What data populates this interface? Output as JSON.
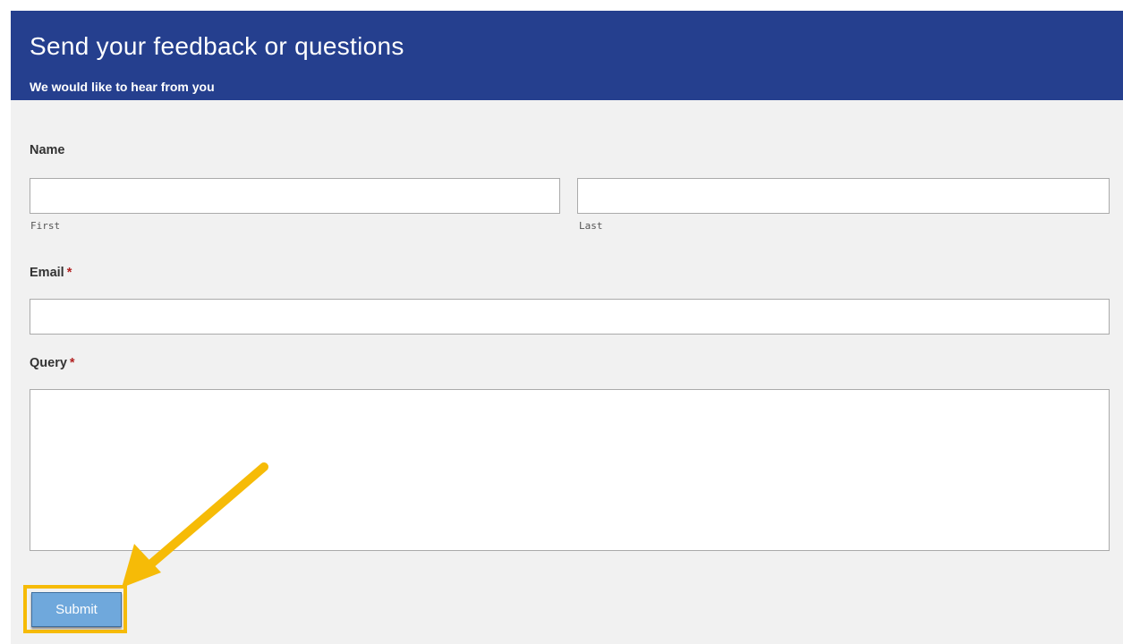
{
  "header": {
    "title": "Send your feedback or questions",
    "subtitle": "We would like to hear from you"
  },
  "form": {
    "name": {
      "label": "Name",
      "first_value": "",
      "first_sublabel": "First",
      "last_value": "",
      "last_sublabel": "Last"
    },
    "email": {
      "label": "Email",
      "required_marker": "*",
      "value": ""
    },
    "query": {
      "label": "Query",
      "required_marker": "*",
      "value": ""
    },
    "submit_label": "Submit"
  },
  "colors": {
    "header_bg": "#253f8e",
    "form_bg": "#f1f1f1",
    "submit_bg": "#6fa8dc",
    "highlight": "#f6bb07",
    "required": "#b22222"
  },
  "annotation": {
    "arrow_icon": "arrow-pointing-to-submit-icon"
  }
}
